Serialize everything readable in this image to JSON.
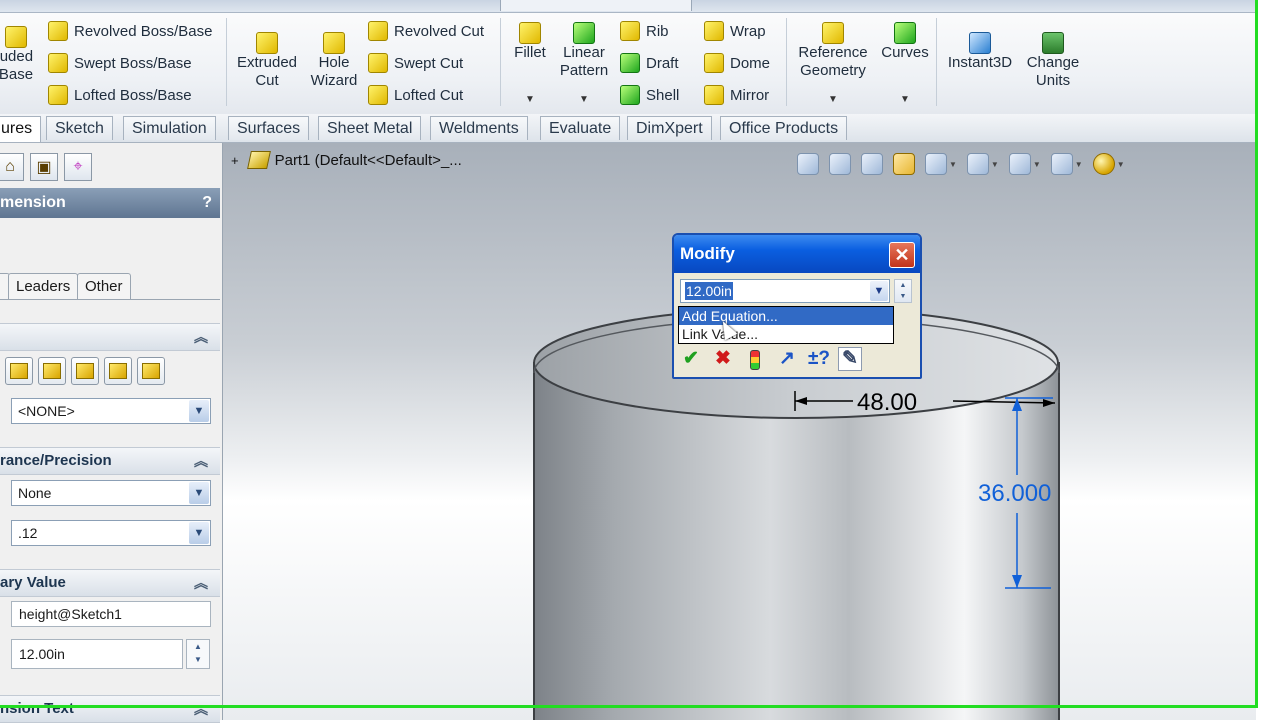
{
  "ribbon": {
    "boss_group": {
      "extruded_partial": "uded\nBase",
      "revolved": "Revolved Boss/Base",
      "swept": "Swept Boss/Base",
      "lofted": "Lofted Boss/Base"
    },
    "cut_group": {
      "extruded_cut": "Extruded\nCut",
      "hole_wizard": "Hole\nWizard",
      "revolved_cut": "Revolved Cut",
      "swept_cut": "Swept Cut",
      "lofted_cut": "Lofted Cut"
    },
    "features_group": {
      "fillet": "Fillet",
      "linear_pattern": "Linear\nPattern",
      "rib": "Rib",
      "draft": "Draft",
      "shell": "Shell",
      "wrap": "Wrap",
      "dome": "Dome",
      "mirror": "Mirror"
    },
    "ref_group": {
      "reference_geometry": "Reference\nGeometry",
      "curves": "Curves"
    },
    "extra_group": {
      "instant3d": "Instant3D",
      "change_units": "Change\nUnits"
    }
  },
  "tabs": [
    "ures",
    "Sketch",
    "Simulation",
    "Surfaces",
    "Sheet Metal",
    "Weldments",
    "Evaluate",
    "DimXpert",
    "Office Products"
  ],
  "property_manager": {
    "header": "mension",
    "help": "?",
    "subtabs": [
      "Leaders",
      "Other"
    ],
    "style_combo": "<NONE>",
    "tolerance_section": "rance/Precision",
    "tolerance_value": "None",
    "precision_value": ".12",
    "primary_section": "ary Value",
    "primary_name": "height@Sketch1",
    "primary_value": "12.00in",
    "dimension_text_section": "nsion Text"
  },
  "graphics": {
    "tree_label": "Part1  (Default<<Default>_..."
  },
  "dimensions": {
    "width": "48.00",
    "height": "36.000"
  },
  "modify_dialog": {
    "title": "Modify",
    "close": "✕",
    "value": "12.00in",
    "menu_items": [
      "Add Equation...",
      "Link Value..."
    ],
    "highlighted_index": 0
  },
  "colors": {
    "accent_frame": "#22dd22",
    "selection": "#316ac5",
    "dimension_selected": "#1060d8"
  }
}
